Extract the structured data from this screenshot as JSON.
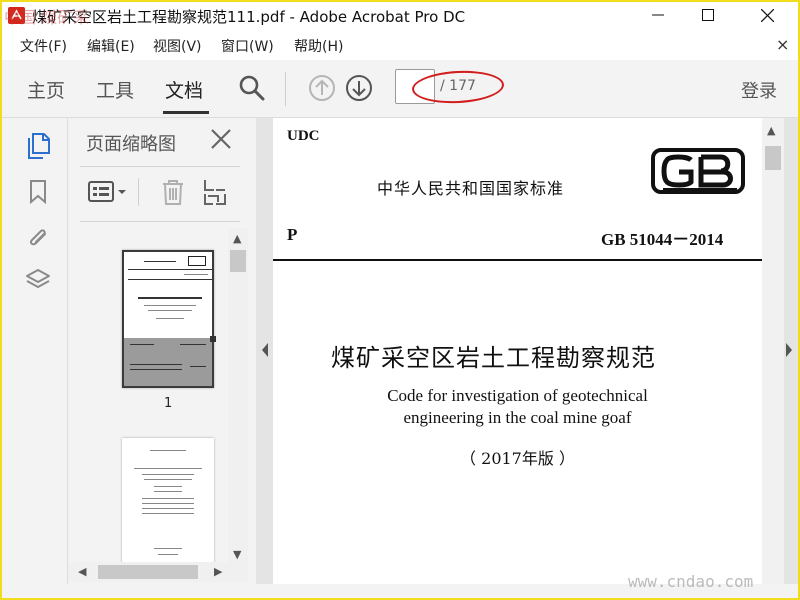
{
  "window": {
    "title": "煤矿采空区岩土工程勘察规范111.pdf - Adobe Acrobat Pro DC",
    "minimize": "—",
    "maximize": "☐",
    "close": "✕"
  },
  "menu": {
    "items": [
      "文件(F)",
      "编辑(E)",
      "视图(V)",
      "窗口(W)",
      "帮助(H)"
    ],
    "close": "×"
  },
  "toolbar": {
    "tabs": [
      "主页",
      "工具",
      "文档"
    ],
    "active_tab": "文档",
    "page_current": "",
    "page_total": "/ 177",
    "login": "登录",
    "icons": [
      "search-icon",
      "previous-page-icon",
      "next-page-icon"
    ]
  },
  "left_rail": {
    "icons": [
      "pages-thumbnails-icon",
      "bookmark-icon",
      "attachment-icon",
      "layers-icon"
    ],
    "active": "pages-thumbnails-icon"
  },
  "thumbnails": {
    "title": "页面缩略图",
    "page_label": "1",
    "tools": [
      "thumbnail-options-icon",
      "delete-page-icon",
      "extract-page-icon"
    ]
  },
  "document": {
    "udc": "UDC",
    "standard_org": "中华人民共和国国家标准",
    "gb_logo": "GB",
    "classification": "P",
    "standard_number": "GB 51044－2014",
    "title_cn": "煤矿采空区岩土工程勘察规范",
    "title_en_line1": "Code for investigation of geotechnical",
    "title_en_line2": "engineering in the coal mine goaf",
    "edition": "（ 2017年版 ）"
  },
  "watermarks": {
    "top_left": "中国 煤矿采",
    "bottom_right": "www.cndao.com"
  },
  "colors": {
    "accent_icon": "#2d6fcf",
    "annotation_red": "#d21d1d",
    "window_border": "#f2dd1c"
  }
}
